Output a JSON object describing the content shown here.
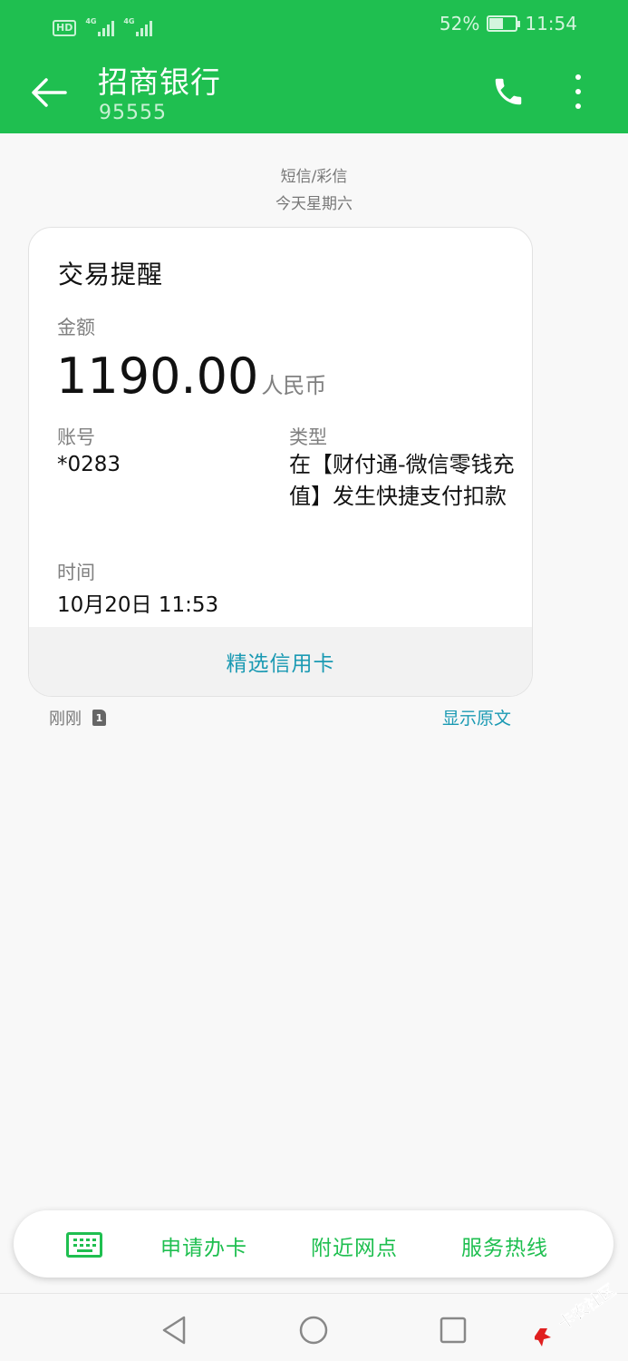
{
  "status_bar": {
    "hd_label": "HD",
    "network_labels": [
      "4G",
      "4G"
    ],
    "battery_text": "52%",
    "battery_level": 0.52,
    "time": "11:54"
  },
  "header": {
    "title": "招商银行",
    "subtitle": "95555",
    "background": "#1fbf50"
  },
  "thread": {
    "channel": "短信/彩信",
    "date": "今天星期六"
  },
  "card": {
    "title": "交易提醒",
    "amount_label": "金额",
    "amount_value": "1190.00",
    "amount_unit": "人民币",
    "account_label": "账号",
    "account_value": "*0283",
    "type_label": "类型",
    "type_value": "在【财付通-微信零钱充值】发生快捷支付扣款",
    "time_label": "时间",
    "time_value": "10月20日 11:53",
    "footer_link": "精选信用卡"
  },
  "message_meta": {
    "received": "刚刚",
    "sim": "1",
    "show_original": "显示原文"
  },
  "quick_menu": {
    "keyboard_icon": "keyboard-icon",
    "items": [
      "申请办卡",
      "附近网点",
      "服务热线"
    ],
    "accent": "#1fbf50"
  },
  "nav": {
    "back_icon": "triangle-back-icon",
    "home_icon": "circle-home-icon",
    "recent_icon": "square-recent-icon"
  },
  "watermark": {
    "text": "卡农社区"
  }
}
